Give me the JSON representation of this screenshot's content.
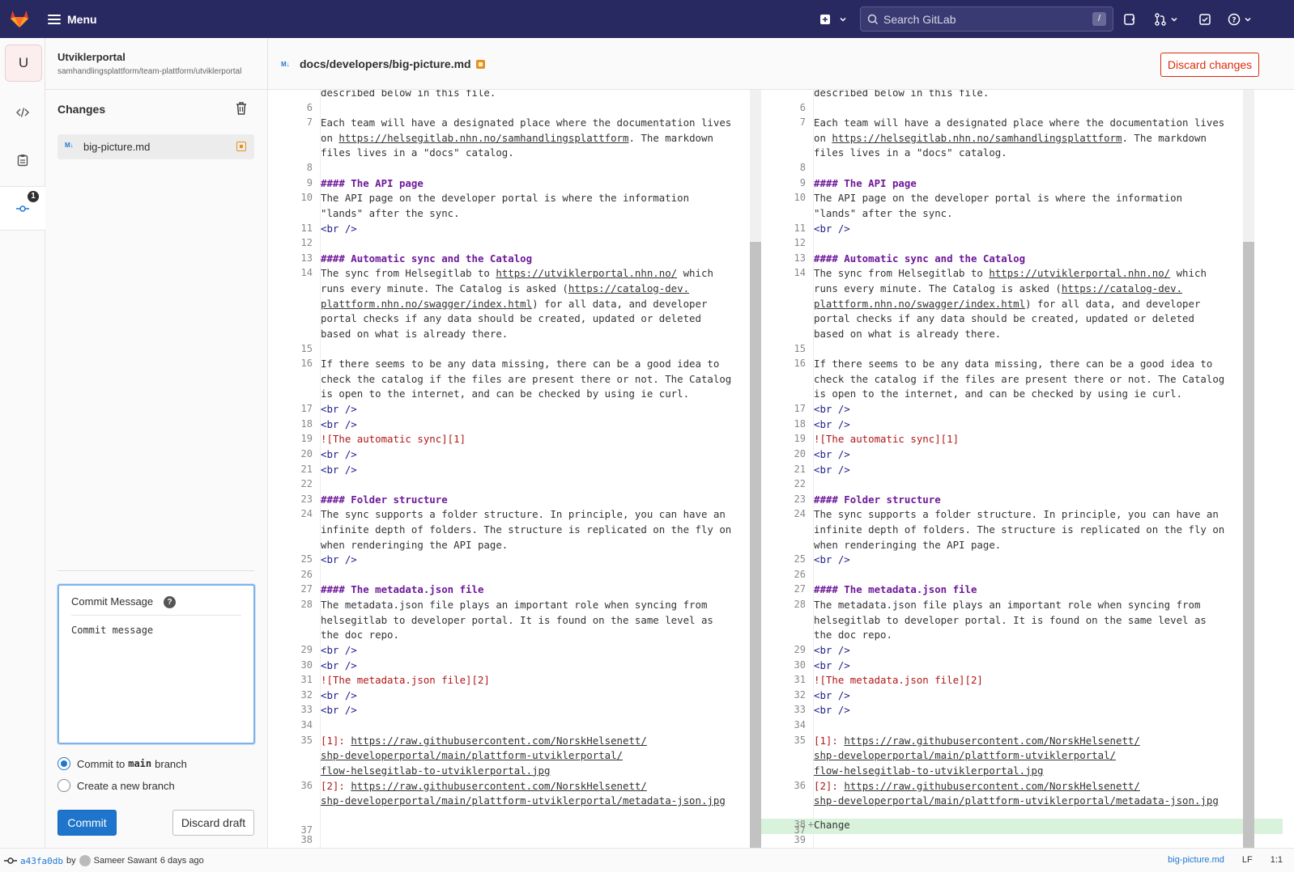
{
  "topbar": {
    "menu_label": "Menu",
    "search_placeholder": "Search GitLab",
    "search_shortcut": "/"
  },
  "project": {
    "avatar_letter": "U",
    "name": "Utviklerportal",
    "path": "samhandlingsplattform/team-plattform/utviklerportal"
  },
  "iconbar": {
    "badge_count": "1"
  },
  "changes": {
    "title": "Changes",
    "files": [
      {
        "name": "big-picture.md",
        "status": "modified"
      }
    ]
  },
  "commit": {
    "label": "Commit Message",
    "help": "?",
    "placeholder": "Commit message",
    "option_main_prefix": "Commit to",
    "option_main_branch": "main",
    "option_main_suffix": "branch",
    "option_new": "Create a new branch",
    "commit_button": "Commit",
    "discard_draft_button": "Discard draft"
  },
  "file_header": {
    "path": "docs/developers/big-picture.md",
    "discard_button": "Discard changes"
  },
  "editor": {
    "lines": [
      {
        "n": "",
        "t": "described below in this file."
      },
      {
        "n": "6",
        "t": ""
      },
      {
        "n": "7",
        "t": "Each team will have a designated place where the documentation lives"
      },
      {
        "n": "",
        "t": "on https://helsegitlab.nhn.no/samhandlingsplattform. The markdown"
      },
      {
        "n": "",
        "t": "files lives in a \"docs\" catalog."
      },
      {
        "n": "8",
        "t": ""
      },
      {
        "n": "9",
        "t": "#### The API page"
      },
      {
        "n": "10",
        "t": "The API page on the developer portal is where the information"
      },
      {
        "n": "",
        "t": "\"lands\" after the sync."
      },
      {
        "n": "11",
        "t": "<br />"
      },
      {
        "n": "12",
        "t": ""
      },
      {
        "n": "13",
        "t": "#### Automatic sync and the Catalog"
      },
      {
        "n": "14",
        "t": "The sync from Helsegitlab to https://utviklerportal.nhn.no/ which"
      },
      {
        "n": "",
        "t": "runs every minute. The Catalog is asked (https://catalog-dev."
      },
      {
        "n": "",
        "t": "plattform.nhn.no/swagger/index.html) for all data, and developer"
      },
      {
        "n": "",
        "t": "portal checks if any data should be created, updated or deleted"
      },
      {
        "n": "",
        "t": "based on what is already there."
      },
      {
        "n": "15",
        "t": ""
      },
      {
        "n": "16",
        "t": "If there seems to be any data missing, there can be a good idea to"
      },
      {
        "n": "",
        "t": "check the catalog if the files are present there or not. The Catalog"
      },
      {
        "n": "",
        "t": "is open to the internet, and can be checked by using ie curl."
      },
      {
        "n": "17",
        "t": "<br />"
      },
      {
        "n": "18",
        "t": "<br />"
      },
      {
        "n": "19",
        "t": "![The automatic sync][1]"
      },
      {
        "n": "20",
        "t": "<br />"
      },
      {
        "n": "21",
        "t": "<br />"
      },
      {
        "n": "22",
        "t": ""
      },
      {
        "n": "23",
        "t": "#### Folder structure"
      },
      {
        "n": "24",
        "t": "The sync supports a folder structure. In principle, you can have an"
      },
      {
        "n": "",
        "t": "infinite depth of folders. The structure is replicated on the fly on"
      },
      {
        "n": "",
        "t": "when renderinging the API page."
      },
      {
        "n": "25",
        "t": "<br />"
      },
      {
        "n": "26",
        "t": ""
      },
      {
        "n": "27",
        "t": "#### The metadata.json file"
      },
      {
        "n": "28",
        "t": "The metadata.json file plays an important role when syncing from"
      },
      {
        "n": "",
        "t": "helsegitlab to developer portal. It is found on the same level as"
      },
      {
        "n": "",
        "t": "the doc repo."
      },
      {
        "n": "29",
        "t": "<br />"
      },
      {
        "n": "30",
        "t": "<br />"
      },
      {
        "n": "31",
        "t": "![The metadata.json file][2]"
      },
      {
        "n": "32",
        "t": "<br />"
      },
      {
        "n": "33",
        "t": "<br />"
      },
      {
        "n": "34",
        "t": ""
      },
      {
        "n": "35",
        "t": "[1]: https://raw.githubusercontent.com/NorskHelsenett/"
      },
      {
        "n": "",
        "t": "shp-developerportal/main/plattform-utviklerportal/"
      },
      {
        "n": "",
        "t": "flow-helsegitlab-to-utviklerportal.jpg"
      },
      {
        "n": "36",
        "t": "[2]: https://raw.githubusercontent.com/NorskHelsenett/"
      },
      {
        "n": "",
        "t": "shp-developerportal/main/plattform-utviklerportal/metadata-json.jpg"
      },
      {
        "n": "",
        "t": ""
      },
      {
        "n": "37",
        "t": ""
      }
    ],
    "left_tail": [
      {
        "n": "38",
        "t": ""
      }
    ],
    "right_tail": [
      {
        "n": "38",
        "t": "Change"
      },
      {
        "n": "39",
        "t": ""
      }
    ]
  },
  "statusbar": {
    "sha": "a43fa0db",
    "by": "by",
    "author": "Sameer Sawant",
    "when": "6 days ago",
    "file": "big-picture.md",
    "eol": "LF",
    "position": "1:1"
  },
  "colors": {
    "topbar": "#292961",
    "primary": "#1f75cb",
    "danger": "#dd2b0e",
    "added": "#d9f2db",
    "modified": "#e69020"
  }
}
